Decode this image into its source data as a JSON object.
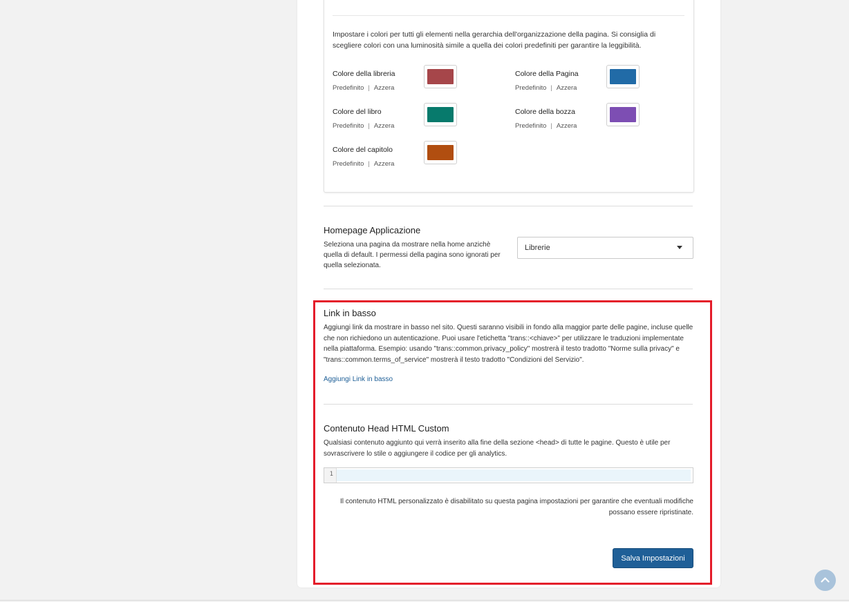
{
  "colors_panel": {
    "description": "Impostare i colori per tutti gli elementi nella gerarchia dell'organizzazione della pagina. Si consiglia di scegliere colori con una luminosità simile a quella dei colori predefiniti per garantire la leggibilità.",
    "items": [
      {
        "label": "Colore della libreria",
        "color": "#a6464a"
      },
      {
        "label": "Colore della Pagina",
        "color": "#216ba7"
      },
      {
        "label": "Colore del libro",
        "color": "#077a6c"
      },
      {
        "label": "Colore della bozza",
        "color": "#7d4eb3"
      },
      {
        "label": "Colore del capitolo",
        "color": "#b14e10"
      }
    ],
    "default_label": "Predefinito",
    "reset_label": "Azzera",
    "separator": "|"
  },
  "homepage": {
    "title": "Homepage Applicazione",
    "description": "Seleziona una pagina da mostrare nella home anzichè quella di default. I permessi della pagina sono ignorati per quella selezionata.",
    "select_value": "Librerie"
  },
  "footer_links": {
    "title": "Link in basso",
    "description": "Aggiungi link da mostrare in basso nel sito. Questi saranno visibili in fondo alla maggior parte delle pagine, incluse quelle che non richiedono un autenticazione. Puoi usare l'etichetta \"trans::<chiave>\" per utilizzare le traduzioni implementate nella piattaforma. Esempio: usando \"trans::common.privacy_policy\" mostrerà il testo tradotto \"Norme sulla privacy\" e \"trans::common.terms_of_service\" mostrerà il testo tradotto \"Condizioni del Servizio\".",
    "add_link": "Aggiungi Link in basso"
  },
  "custom_head": {
    "title": "Contenuto Head HTML Custom",
    "description": "Qualsiasi contenuto aggiunto qui verrà inserito alla fine della sezione <head> di tutte le pagine. Questo è utile per sovrascrivere lo stile o aggiungere il codice per gli analytics.",
    "line_number": "1",
    "disabled_note": "Il contenuto HTML personalizzato è disabilitato su questa pagina impostazioni per garantire che eventuali modifiche possano essere ripristinate."
  },
  "save_button": "Salva Impostazioni",
  "icons": {
    "scroll_top": "chevron-up-icon"
  },
  "highlight_color": "#e41c2a"
}
